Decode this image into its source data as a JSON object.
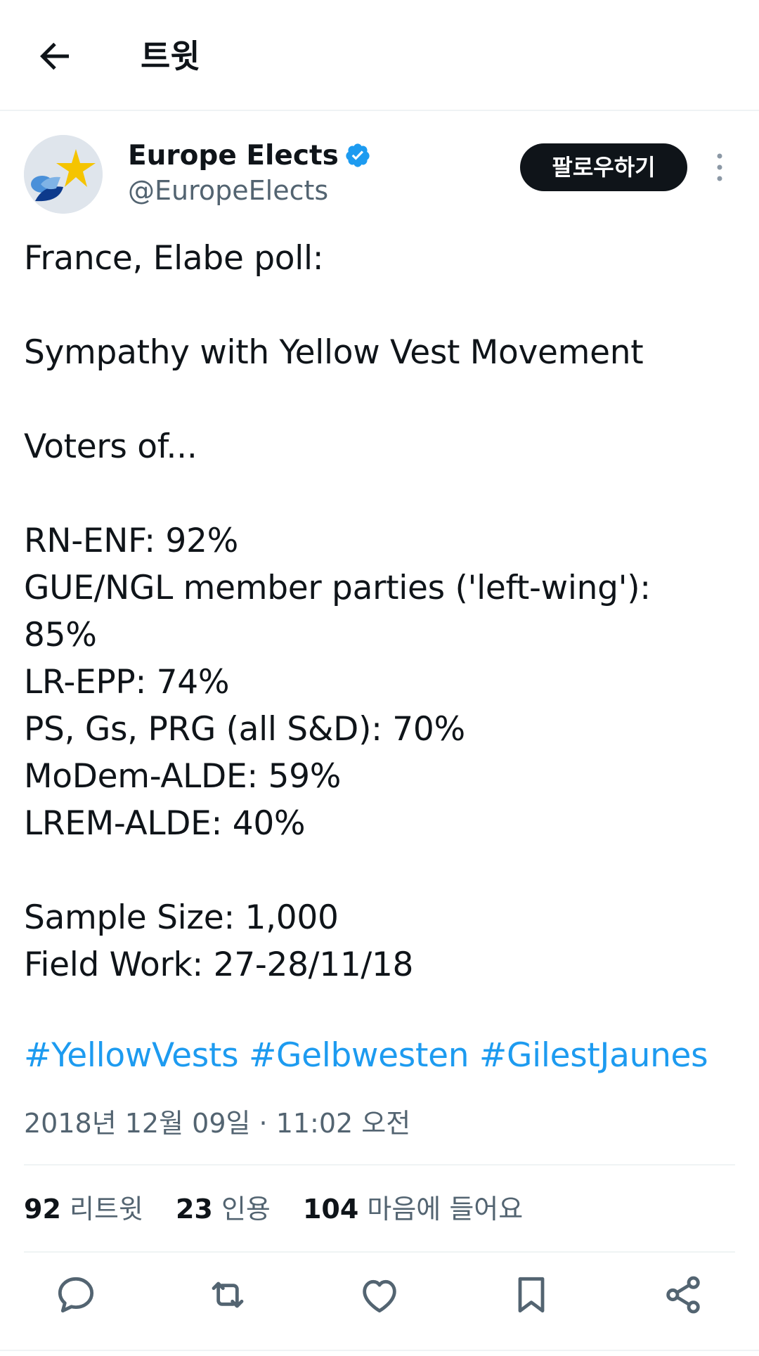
{
  "header": {
    "title": "트윗"
  },
  "author": {
    "display_name": "Europe Elects",
    "handle": "@EuropeElects",
    "verified": true
  },
  "follow_label": "팔로우하기",
  "tweet": {
    "text": "France, Elabe poll:\n\nSympathy with Yellow Vest Movement\n\nVoters of...\n\nRN-ENF: 92%\nGUE/NGL member parties ('left-wing'):\n85%\nLR-EPP: 74%\nPS, Gs, PRG (all S&D): 70%\nMoDem-ALDE: 59%\nLREM-ALDE: 40%\n\nSample Size: 1,000\nField Work: 27-28/11/18",
    "hashtags": [
      "#YellowVests",
      "#Gelbwesten",
      "#GilestJaunes"
    ],
    "timestamp": "2018년 12월 09일 · 11:02 오전"
  },
  "stats": {
    "retweets": "92",
    "retweets_label": "리트윗",
    "quotes": "23",
    "quotes_label": "인용",
    "likes": "104",
    "likes_label": "마음에 들어요"
  },
  "actions": [
    "reply-icon",
    "retweet-icon",
    "like-icon",
    "bookmark-icon",
    "share-icon"
  ],
  "colors": {
    "link": "#1d9bf0",
    "verified": "#1d9bf0",
    "secondary_text": "#536471",
    "text": "#0f1419"
  }
}
